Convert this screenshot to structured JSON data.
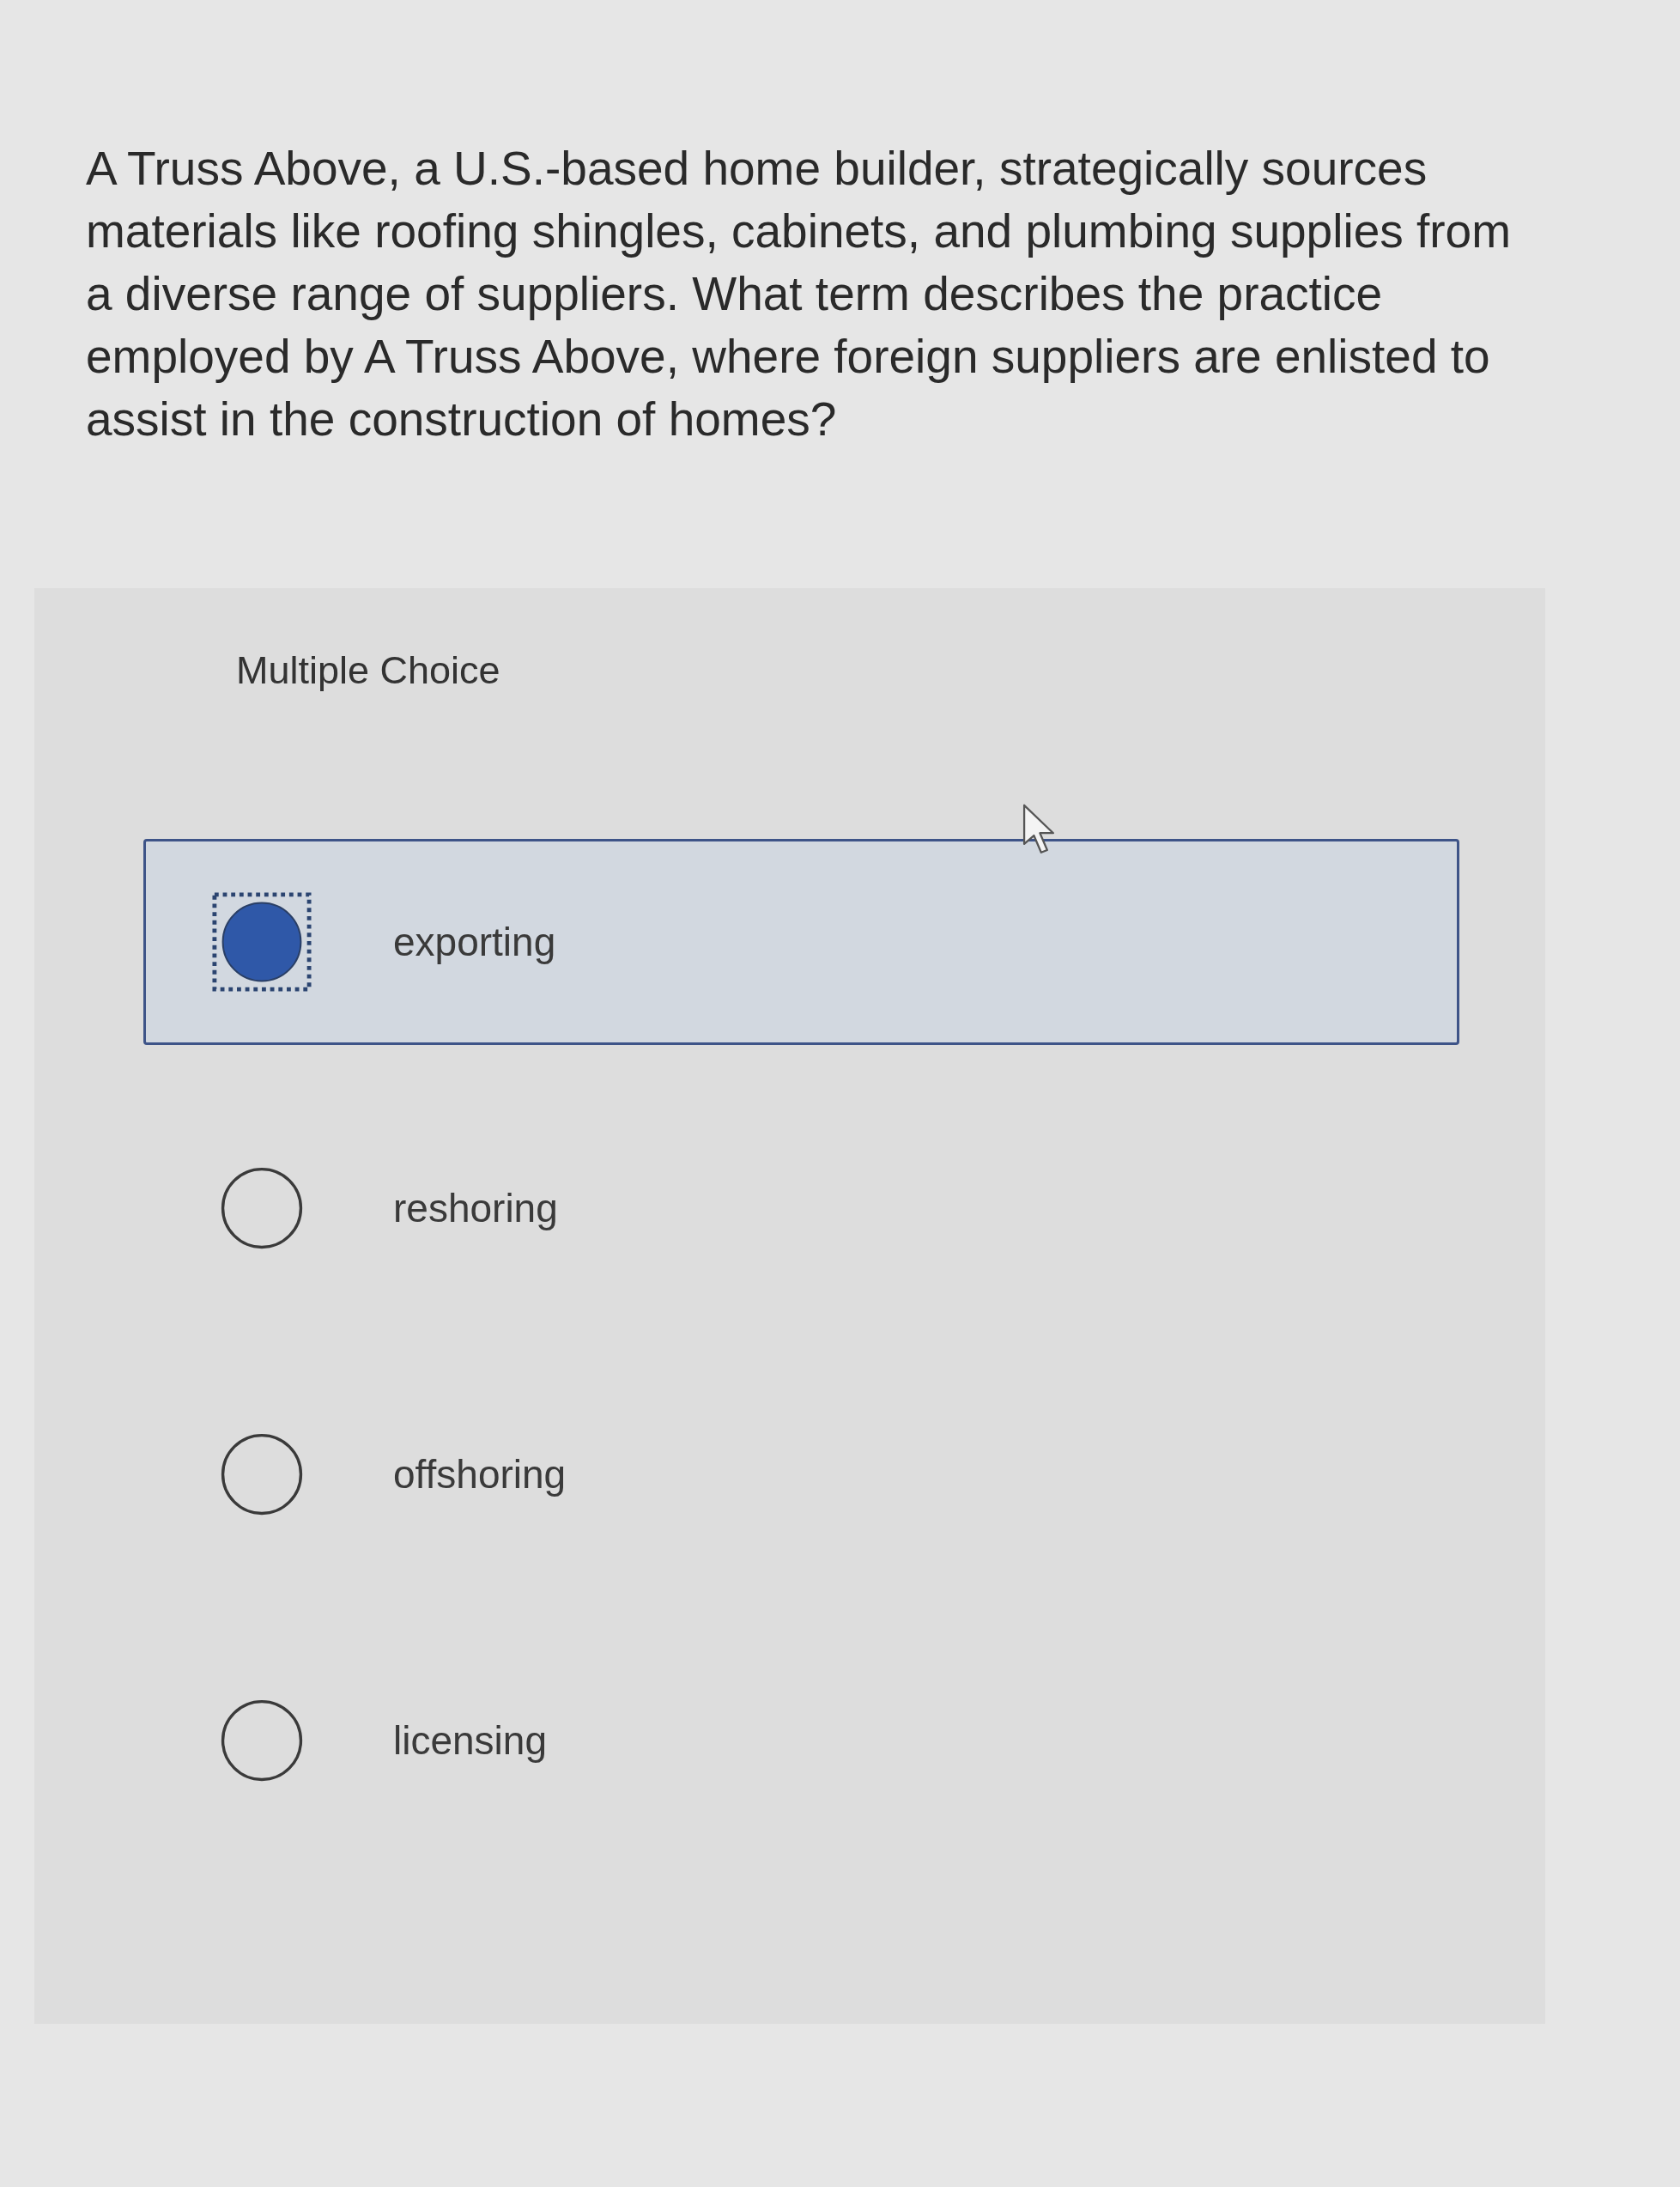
{
  "question": "A Truss Above, a U.S.-based home builder, strategically sources materials like roofing shingles, cabinets, and plumbing supplies from a diverse range of suppliers. What term describes the practice employed by A Truss Above, where foreign suppliers are enlisted to assist in the construction of homes?",
  "section_label": "Multiple Choice",
  "options": [
    {
      "label": "exporting",
      "selected": true
    },
    {
      "label": "reshoring",
      "selected": false
    },
    {
      "label": "offshoring",
      "selected": false
    },
    {
      "label": "licensing",
      "selected": false
    }
  ]
}
